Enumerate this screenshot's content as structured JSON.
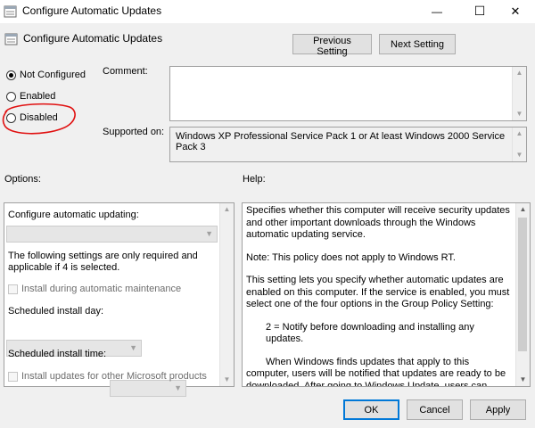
{
  "window": {
    "title": "Configure Automatic Updates",
    "minimize_glyph": "—",
    "maximize_glyph": "☐",
    "close_glyph": "✕"
  },
  "policy": {
    "title": "Configure Automatic Updates",
    "prev_button": "Previous Setting",
    "next_button": "Next Setting"
  },
  "state": {
    "options": [
      {
        "label": "Not Configured",
        "checked": true
      },
      {
        "label": "Enabled",
        "checked": false
      },
      {
        "label": "Disabled",
        "checked": false
      }
    ],
    "annotation_color": "#e01010"
  },
  "comment": {
    "label": "Comment:",
    "value": ""
  },
  "supported": {
    "label": "Supported on:",
    "value": "Windows XP Professional Service Pack 1 or At least Windows 2000 Service Pack 3"
  },
  "options_panel": {
    "heading": "Options:",
    "configure_label": "Configure automatic updating:",
    "configure_value": "",
    "note": "The following settings are only required and applicable if 4 is selected.",
    "maintenance_checkbox": "Install during automatic maintenance",
    "day_label": "Scheduled install day:",
    "day_value": "",
    "time_label": "Scheduled install time:",
    "time_value": "",
    "other_products_checkbox": "Install updates for other Microsoft products"
  },
  "help_panel": {
    "heading": "Help:",
    "paragraphs": [
      "Specifies whether this computer will receive security updates and other important downloads through the Windows automatic updating service.",
      "Note: This policy does not apply to Windows RT.",
      "This setting lets you specify whether automatic updates are enabled on this computer. If the service is enabled, you must select one of the four options in the Group Policy Setting:",
      "2 = Notify before downloading and installing any updates.",
      "When Windows finds updates that apply to this computer, users will be notified that updates are ready to be downloaded. After going to Windows Update, users can download and install"
    ]
  },
  "footer": {
    "ok": "OK",
    "cancel": "Cancel",
    "apply": "Apply"
  }
}
